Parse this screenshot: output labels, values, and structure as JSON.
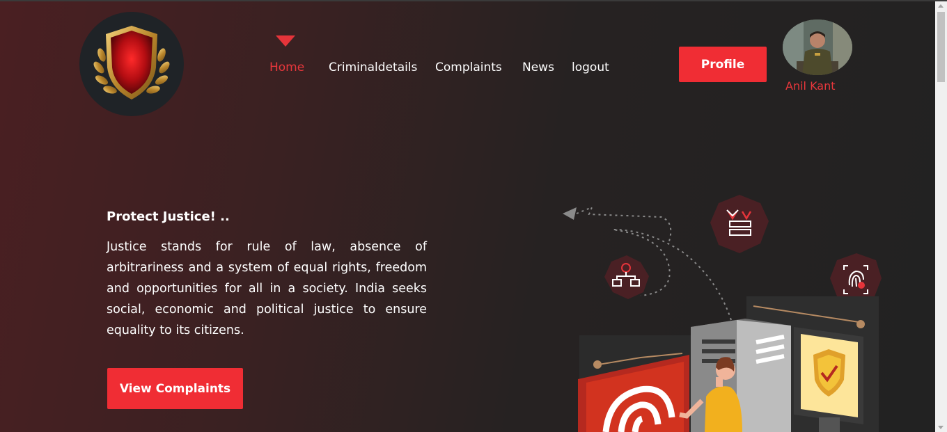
{
  "header": {
    "nav": [
      {
        "label": "Home",
        "active": true
      },
      {
        "label": "Criminaldetails",
        "active": false
      },
      {
        "label": "Complaints",
        "active": false
      },
      {
        "label": "News",
        "active": false
      },
      {
        "label": "logout",
        "active": false
      }
    ],
    "profile_button": "Profile",
    "user_name": "Anil Kant"
  },
  "hero": {
    "title": "Protect Justice! ..",
    "text": "Justice stands for rule of law, absence of arbitrariness and a system of equal rights, freedom and opportunities for all in a society. India seeks social, economic and political justice to ensure equality to its citizens.",
    "cta": "View Complaints"
  },
  "icons": {
    "logo": "shield-laurel-logo",
    "nav_indicator": "triangle-down-icon",
    "illustration": "cyber-security-illustration"
  },
  "colors": {
    "accent": "#f02d34",
    "background_left": "#4a1f22",
    "background_right": "#222222"
  }
}
